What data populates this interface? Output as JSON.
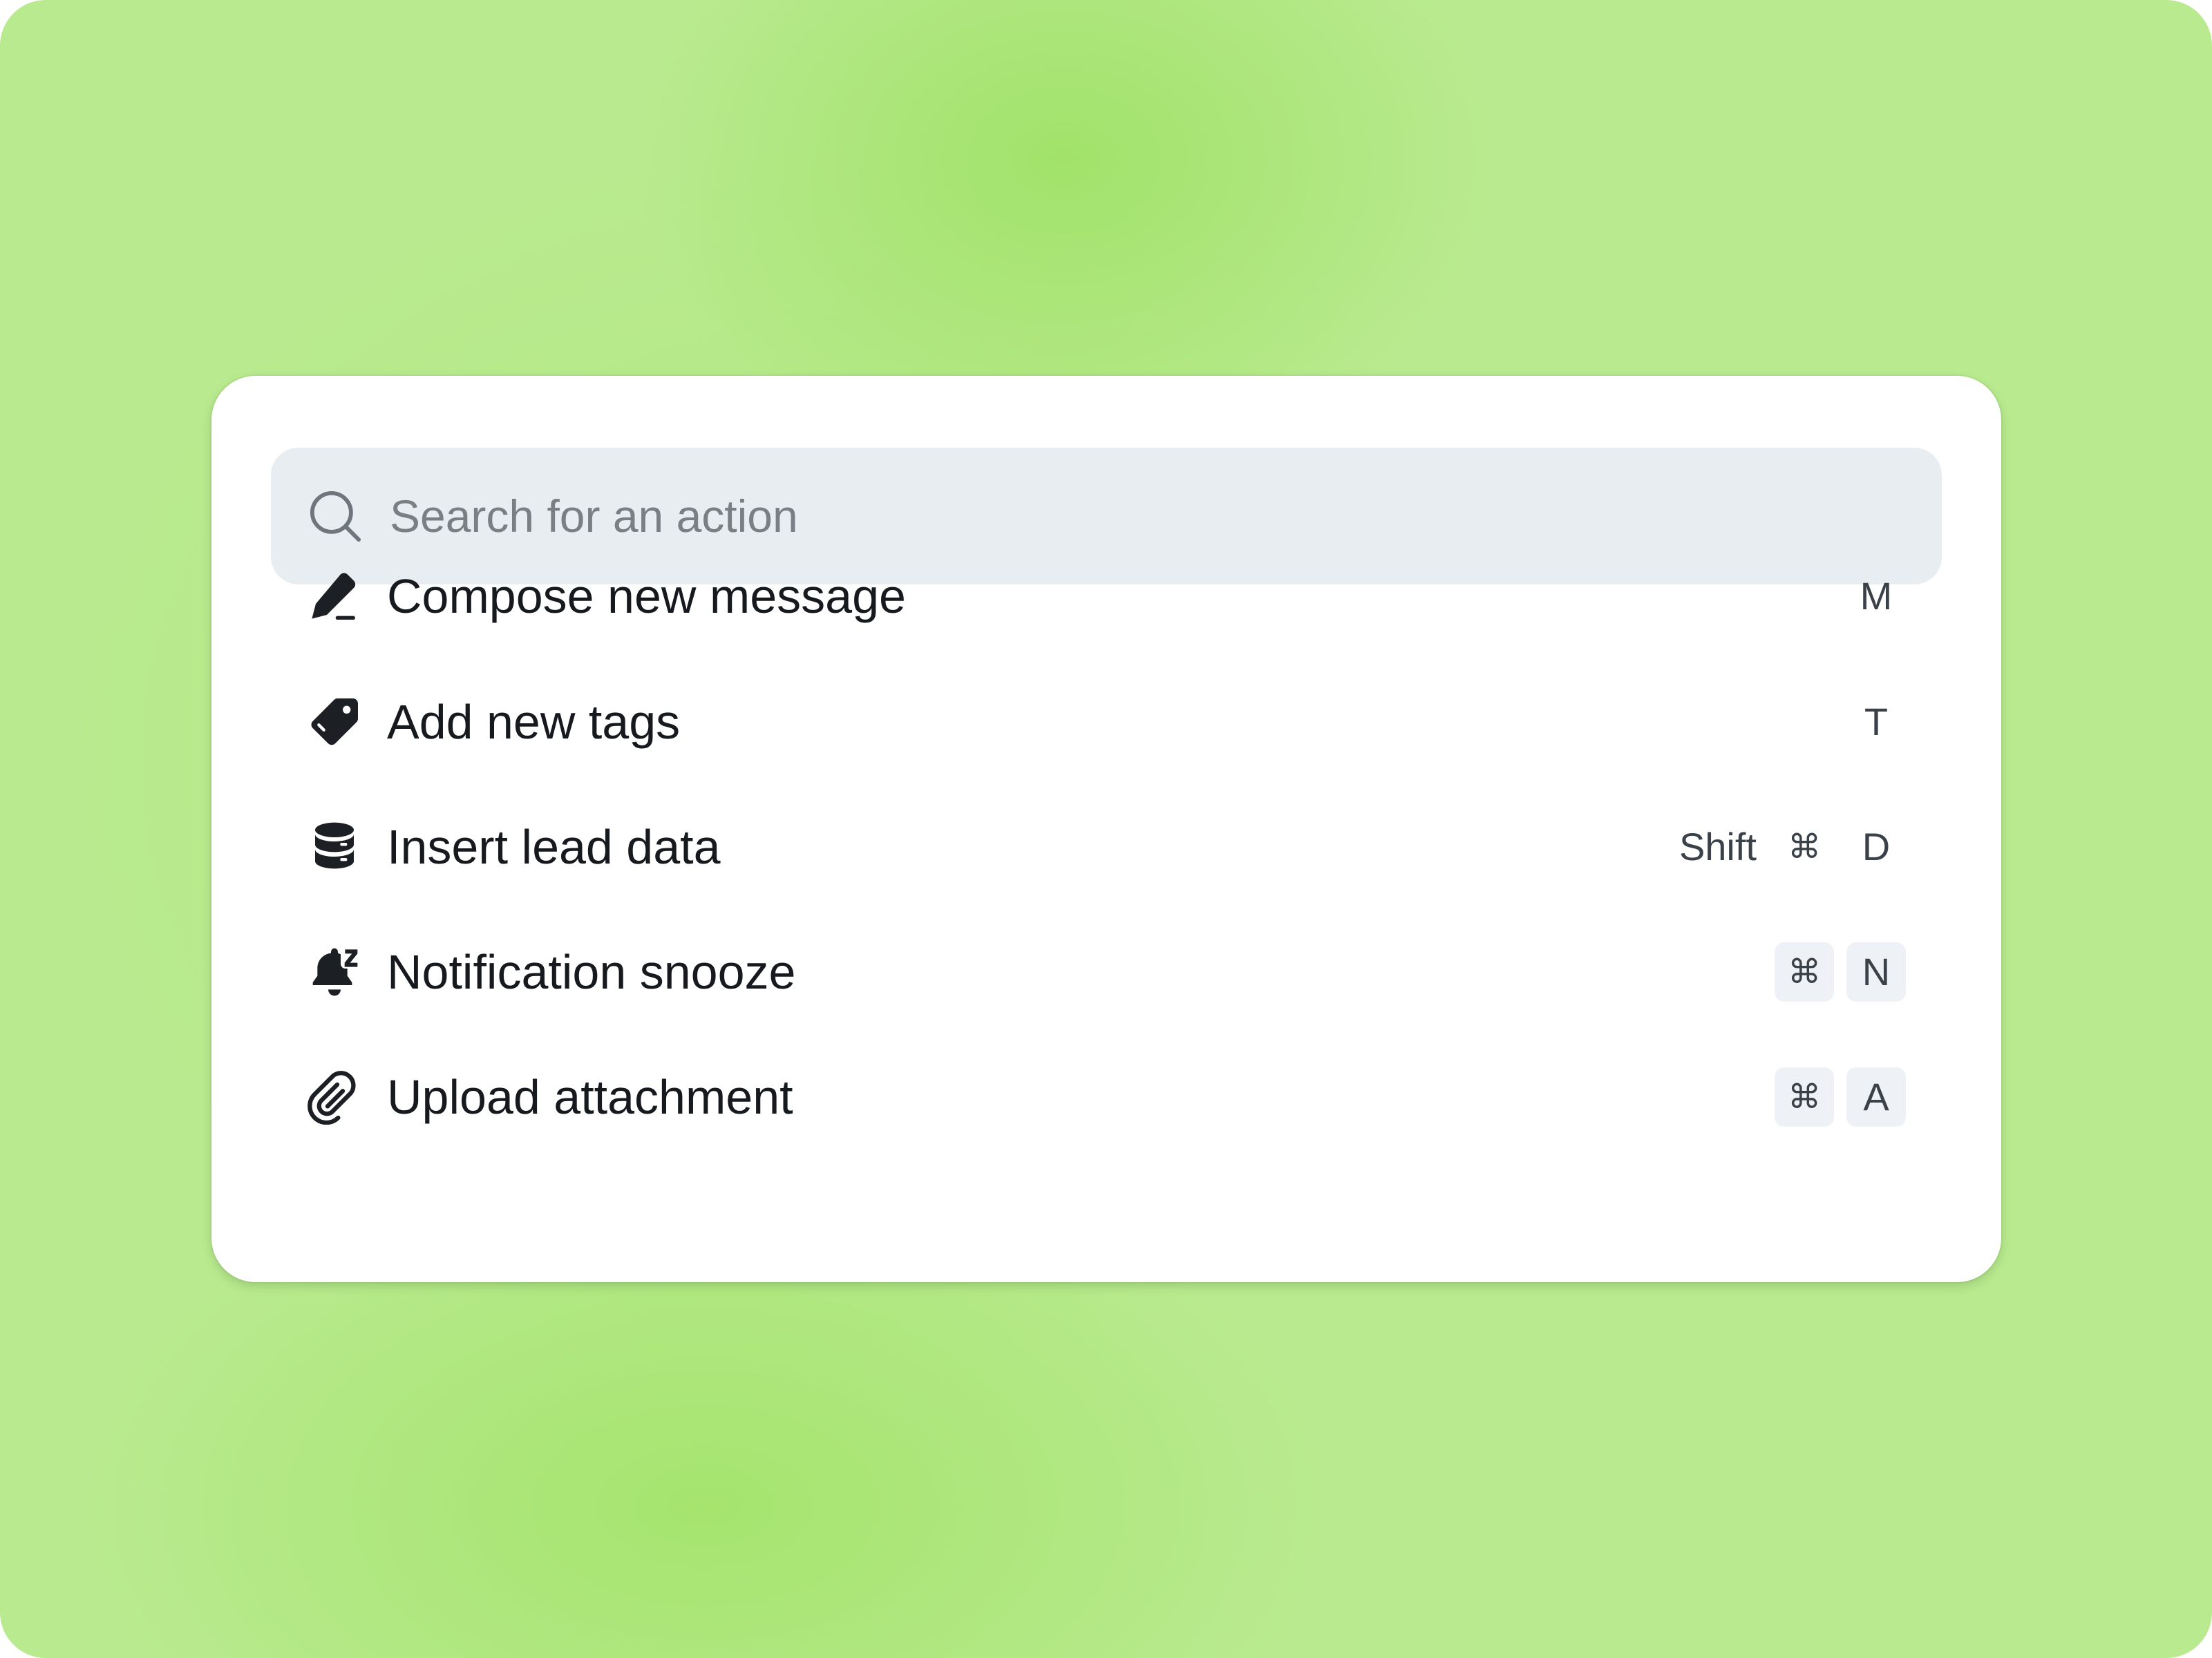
{
  "search": {
    "placeholder": "Search for an action",
    "icon": "search-icon"
  },
  "actions": [
    {
      "label": "Compose new message",
      "icon": "pencil-icon",
      "shortcut": [
        {
          "key": "M",
          "boxed": false
        }
      ]
    },
    {
      "label": "Add new tags",
      "icon": "tag-icon",
      "shortcut": [
        {
          "key": "T",
          "boxed": false
        }
      ]
    },
    {
      "label": "Insert lead data",
      "icon": "database-icon",
      "shortcut": [
        {
          "key": "Shift",
          "boxed": false
        },
        {
          "key": "⌘",
          "boxed": false
        },
        {
          "key": "D",
          "boxed": false
        }
      ]
    },
    {
      "label": "Notification snooze",
      "icon": "bell-snooze-icon",
      "shortcut": [
        {
          "key": "⌘",
          "boxed": true
        },
        {
          "key": "N",
          "boxed": true
        }
      ]
    },
    {
      "label": "Upload attachment",
      "icon": "paperclip-icon",
      "shortcut": [
        {
          "key": "⌘",
          "boxed": true
        },
        {
          "key": "A",
          "boxed": true
        }
      ]
    }
  ],
  "colors": {
    "background": "#b9ea8f",
    "background_accent": "#a3e46c",
    "panel": "#ffffff",
    "search_field": "#e8edf1",
    "key_box": "#eef1f5",
    "text": "#16191d",
    "placeholder": "#7a7f86"
  }
}
